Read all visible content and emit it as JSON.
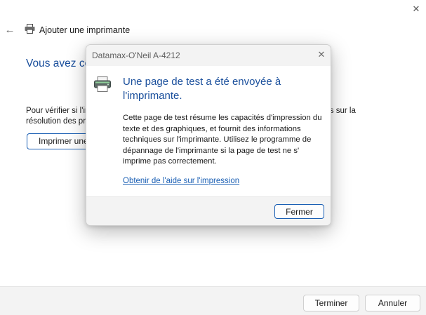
{
  "wizard": {
    "title": "Ajouter une imprimante",
    "heading": "Vous avez correctement ajouté Datamax-O'Neil A-4212",
    "body_text": "Pour vérifier si l'imprimante fonctionne correctement, ou pour afficher des informations sur la résolution des problèmes, imprimez une page de test.",
    "print_test_button": "Imprimer une page de test",
    "icons": {
      "back": "back-arrow-icon",
      "close": "close-icon",
      "printer": "printer-icon"
    }
  },
  "footer": {
    "finish_label": "Terminer",
    "cancel_label": "Annuler"
  },
  "dialog": {
    "title": "Datamax-O'Neil A-4212",
    "heading": "Une page de test a été envoyée à l'imprimante.",
    "description": "Cette page de test résume les capacités d'impression du texte et des graphiques, et fournit des informations techniques sur l'imprimante. Utilisez le programme de dépannage de l'imprimante si la page de test ne s' imprime pas correctement.",
    "help_link": "Obtenir de l'aide sur l'impression",
    "close_label": "Fermer"
  },
  "colors": {
    "accent": "#1a5fb4",
    "heading_blue": "#1a4f9c",
    "footer_bg": "#f3f3f3"
  }
}
